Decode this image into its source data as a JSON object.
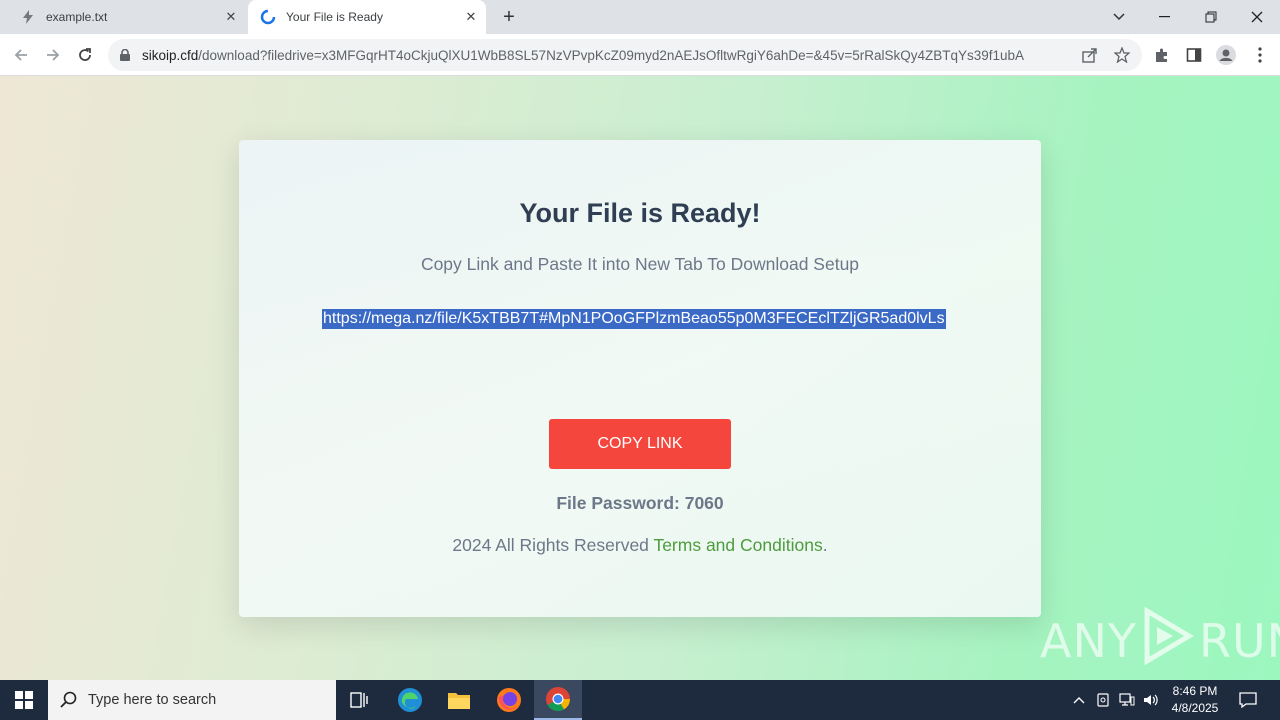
{
  "browser": {
    "tabs": [
      {
        "title": "example.txt",
        "active": false
      },
      {
        "title": "Your File is Ready",
        "active": true
      }
    ],
    "address": {
      "host": "sikoip.cfd",
      "path": "/download?filedrive=x3MFGqrHT4oCkjuQlXU1WbB8SL57NzVPvpKcZ09myd2nAEJsOfltwRgiY6ahDe=&45v=5rRalSkQy4ZBTqYs39f1ubA"
    }
  },
  "page": {
    "heading": "Your File is Ready!",
    "subheading": "Copy Link and Paste It into New Tab To Download Setup",
    "link": "https://mega.nz/file/K5xTBB7T#MpN1POoGFPlzmBeao55p0M3FECEclTZljGR5ad0lvLs",
    "copy_button": "COPY LINK",
    "password": "File Password: 7060",
    "footer_prefix": "2024 All Rights Reserved ",
    "footer_link": "Terms and Conditions",
    "footer_suffix": ".",
    "colors": {
      "button": "#f4463d",
      "terms": "#4d9c3d",
      "heading": "#2f3e53"
    }
  },
  "watermark": {
    "left": "ANY",
    "right": "RUN"
  },
  "taskbar": {
    "search_placeholder": "Type here to search",
    "time": "8:46 PM",
    "date": "4/8/2025"
  }
}
